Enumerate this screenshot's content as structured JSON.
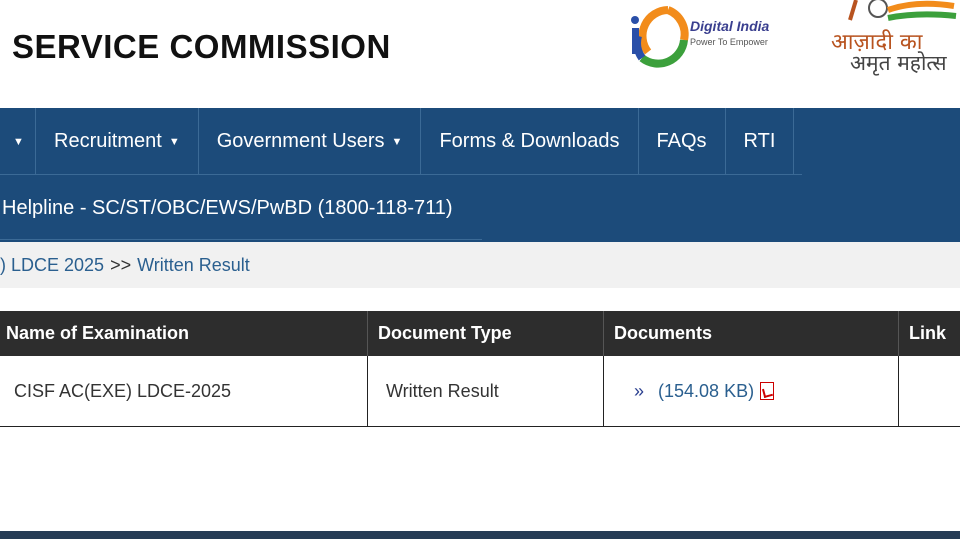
{
  "header": {
    "title": "SERVICE COMMISSION",
    "digital_india": {
      "title": "Digital India",
      "tagline": "Power To Empower"
    },
    "azadi": {
      "line1": "आज़ादी का",
      "line2": "अमृत महोत्स"
    }
  },
  "nav": {
    "items": [
      {
        "label": "Recruitment",
        "dropdown": true
      },
      {
        "label": "Government Users",
        "dropdown": true
      },
      {
        "label": "Forms & Downloads",
        "dropdown": false
      },
      {
        "label": "FAQs",
        "dropdown": false
      },
      {
        "label": "RTI",
        "dropdown": false
      }
    ],
    "helpline": "Helpline - SC/ST/OBC/EWS/PwBD (1800-118-711)"
  },
  "breadcrumb": {
    "parent": ") LDCE 2025",
    "separator": ">>",
    "current": "Written Result"
  },
  "table": {
    "headers": [
      "Name of Examination",
      "Document Type",
      "Documents",
      "Link"
    ],
    "rows": [
      {
        "exam": "CISF AC(EXE) LDCE-2025",
        "doc_type": "Written Result",
        "doc_marker": "»",
        "doc_size": "(154.08 KB)",
        "link": ""
      }
    ]
  },
  "colors": {
    "nav_bg": "#1c4b7a",
    "table_header_bg": "#2d2d2d",
    "link": "#2a5f8f"
  }
}
